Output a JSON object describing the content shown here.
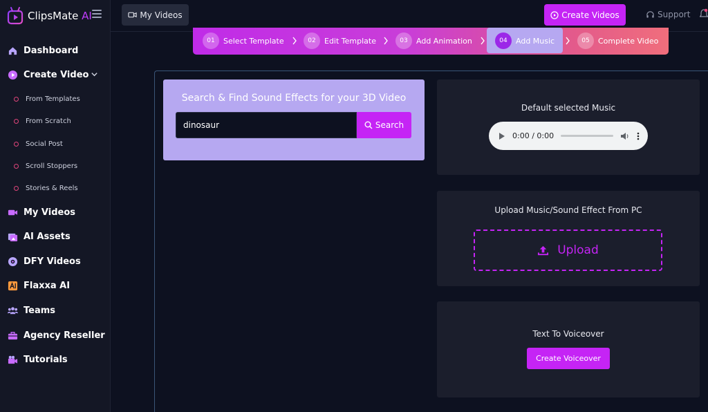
{
  "brand": {
    "name": "ClipsMate",
    "suffix": "AI"
  },
  "sidebar": {
    "items": [
      {
        "label": "Dashboard",
        "icon": "home-icon"
      },
      {
        "label": "Create Video",
        "icon": "play-circle-icon"
      },
      {
        "label": "My Videos",
        "icon": "video-camera-icon"
      },
      {
        "label": "AI Assets",
        "icon": "assets-icon"
      },
      {
        "label": "DFY Videos",
        "icon": "dfy-icon"
      },
      {
        "label": "Flaxxa AI",
        "icon": "flaxxa-ai-icon"
      },
      {
        "label": "Teams",
        "icon": "teams-icon"
      },
      {
        "label": "Agency Reseller",
        "icon": "briefcase-icon"
      },
      {
        "label": "Tutorials",
        "icon": "tutorials-icon"
      }
    ],
    "create_video_subitems": [
      {
        "label": "From Templates"
      },
      {
        "label": "From Scratch"
      },
      {
        "label": "Social Post"
      },
      {
        "label": "Scroll Stoppers"
      },
      {
        "label": "Stories & Reels"
      }
    ]
  },
  "topbar": {
    "my_videos_label": "My Videos",
    "create_videos_label": "Create Videos",
    "support_label": "Support"
  },
  "stepper": {
    "steps": [
      {
        "num": "01",
        "label": "Select Template"
      },
      {
        "num": "02",
        "label": "Edit Template"
      },
      {
        "num": "03",
        "label": "Add Animation"
      },
      {
        "num": "04",
        "label": "Add Music"
      },
      {
        "num": "05",
        "label": "Complete Video"
      }
    ],
    "active_step": "04"
  },
  "search": {
    "title": "Search & Find Sound Effects for your 3D Video",
    "value": "dinosaur",
    "button_label": "Search"
  },
  "default_music": {
    "title": "Default selected Music",
    "time": "0:00 / 0:00"
  },
  "upload": {
    "title": "Upload Music/Sound Effect From PC",
    "button_label": "Upload"
  },
  "voiceover": {
    "title": "Text To Voiceover",
    "button_label": "Create Voiceover"
  },
  "colors": {
    "accent": "#c524f5",
    "background": "#0d1120",
    "sidebar": "#141725",
    "card": "#1b1e2c",
    "search_card": "#b6a8f1"
  }
}
